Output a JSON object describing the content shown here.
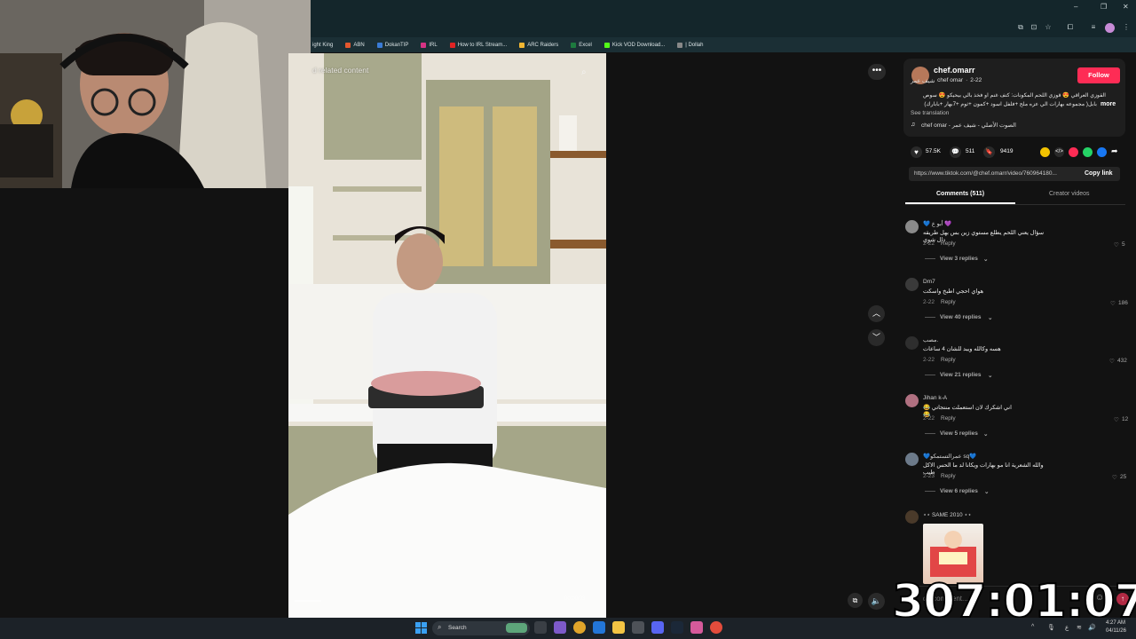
{
  "bookmarks": [
    "ight King",
    "ABN",
    "DokanTIP",
    "IRL",
    "How to IRL Stream...",
    "ARC Raiders",
    "Excel",
    "Kick VOD Download...",
    "| Dollah"
  ],
  "video": {
    "search_related": "d related content"
  },
  "post": {
    "username": "chef.omarr",
    "display_name": "chef omar",
    "display_name_ar": "شيف عمر",
    "date": "2-22",
    "follow_label": "Follow",
    "description_line1": "القوزي العراقي 😍 قوزي اللحم المكونات: كتف غنم او فخذ بالي بيحيكو 😍 سوص",
    "description_line2": "بابل( مجموعه بهارات الي عزه ملح +فلفل اسود +كمون +ثوم +7بهار +بابارك)",
    "more_label": "more",
    "see_translation": "See translation",
    "sound": "chef omar - الصوت الأصلي - شيف عمر",
    "likes": "57.5K",
    "comments": "511",
    "saves": "9419",
    "link": "https://www.tiktok.com/@chef.omarr/video/760964180...",
    "copy_link": "Copy link"
  },
  "tabs": {
    "comments": "Comments (511)",
    "creator_videos": "Creator videos"
  },
  "comments": [
    {
      "user": "💙 أبو ع 💜",
      "text": "سؤال يعني اللحم يطلع مستوي زين بس بهل طريقه دال شوي",
      "date": "2-22",
      "reply": "Reply",
      "likes": "5",
      "replies": "View 3 replies"
    },
    {
      "user": "Dm7",
      "text": "هواي احجي اطبخ واسكت",
      "date": "2-22",
      "reply": "Reply",
      "likes": "186",
      "replies": "View 40 replies"
    },
    {
      "user": "مصب.",
      "text": "هسه وكالله ويبد للشان 4 ساعات",
      "date": "2-22",
      "reply": "Reply",
      "likes": "432",
      "replies": "View 21 replies"
    },
    {
      "user": "Jihan k-A",
      "text": "اني اشكرك لان استعملت منتجاتي 😂😂",
      "date": "2-22",
      "reply": "Reply",
      "likes": "12",
      "replies": "View 5 replies"
    },
    {
      "user": "💙عمرالتستمكو sq💙",
      "text": "والله الشعرية انا مو بهارات ويكانا لد ما الحس الاكل طيب",
      "date": "2-23",
      "reply": "Reply",
      "likes": "25",
      "replies": "View 6 replies"
    },
    {
      "user": "⋆⋆ SAME 2010 ⋆⋆",
      "text": "",
      "date": "",
      "reply": "",
      "likes": "",
      "replies": ""
    }
  ],
  "add_comment": "dd comment...",
  "timer": "307:01:07",
  "taskbar": {
    "search": "Search",
    "time": "4:27 AM",
    "date": "04/11/26"
  },
  "video_time": "00:00/03"
}
